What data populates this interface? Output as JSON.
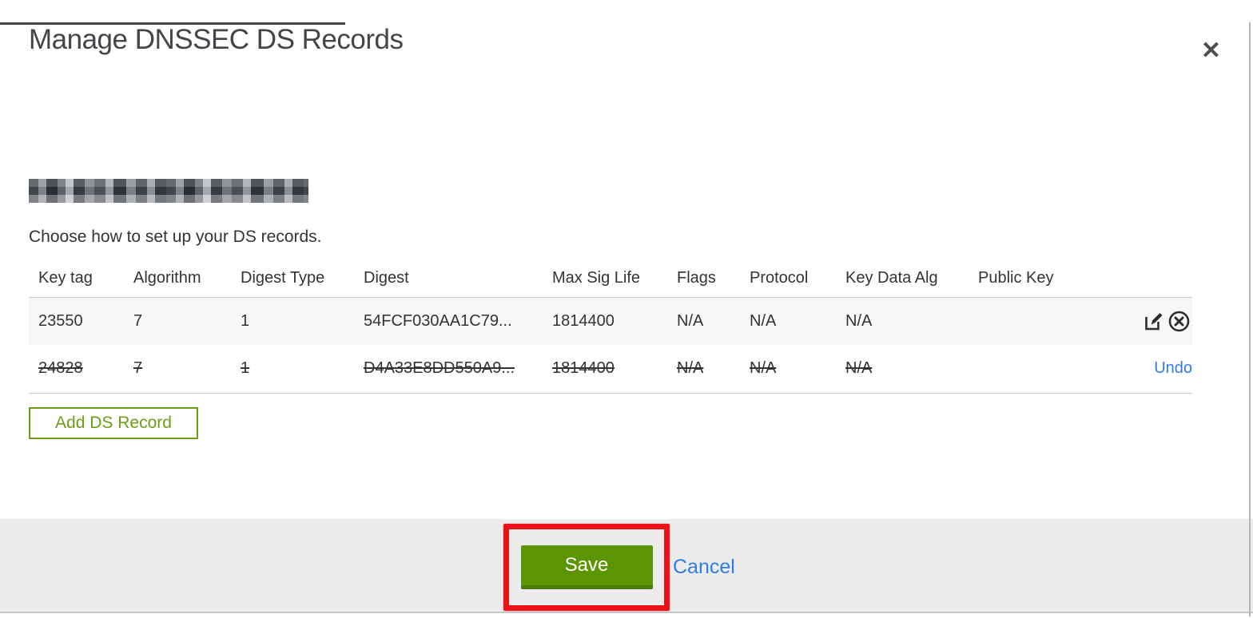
{
  "modal": {
    "title": "Manage DNSSEC DS Records",
    "close_icon": "✕",
    "instruction": "Choose how to set up your DS records.",
    "add_button_label": "Add DS Record"
  },
  "table": {
    "headers": [
      "Key tag",
      "Algorithm",
      "Digest Type",
      "Digest",
      "Max Sig Life",
      "Flags",
      "Protocol",
      "Key Data Alg",
      "Public Key"
    ],
    "rows": [
      {
        "key_tag": "23550",
        "algorithm": "7",
        "digest_type": "1",
        "digest": "54FCF030AA1C79...",
        "max_sig_life": "1814400",
        "flags": "N/A",
        "protocol": "N/A",
        "key_data_alg": "N/A",
        "public_key": "",
        "state": "normal",
        "action_icons": [
          "edit-icon",
          "remove-icon"
        ]
      },
      {
        "key_tag": "24828",
        "algorithm": "7",
        "digest_type": "1",
        "digest": "D4A33E8DD550A9...",
        "max_sig_life": "1814400",
        "flags": "N/A",
        "protocol": "N/A",
        "key_data_alg": "N/A",
        "public_key": "",
        "state": "deleted",
        "action_label": "Undo"
      }
    ]
  },
  "footer": {
    "save_label": "Save",
    "cancel_label": "Cancel"
  },
  "colors": {
    "save_green": "#5c9502",
    "outline_green": "#6b9e17",
    "link_blue": "#2f7de4",
    "annotation_red": "#ea1118",
    "footer_gray": "#ececec",
    "row_gray": "#f7f7f7"
  }
}
